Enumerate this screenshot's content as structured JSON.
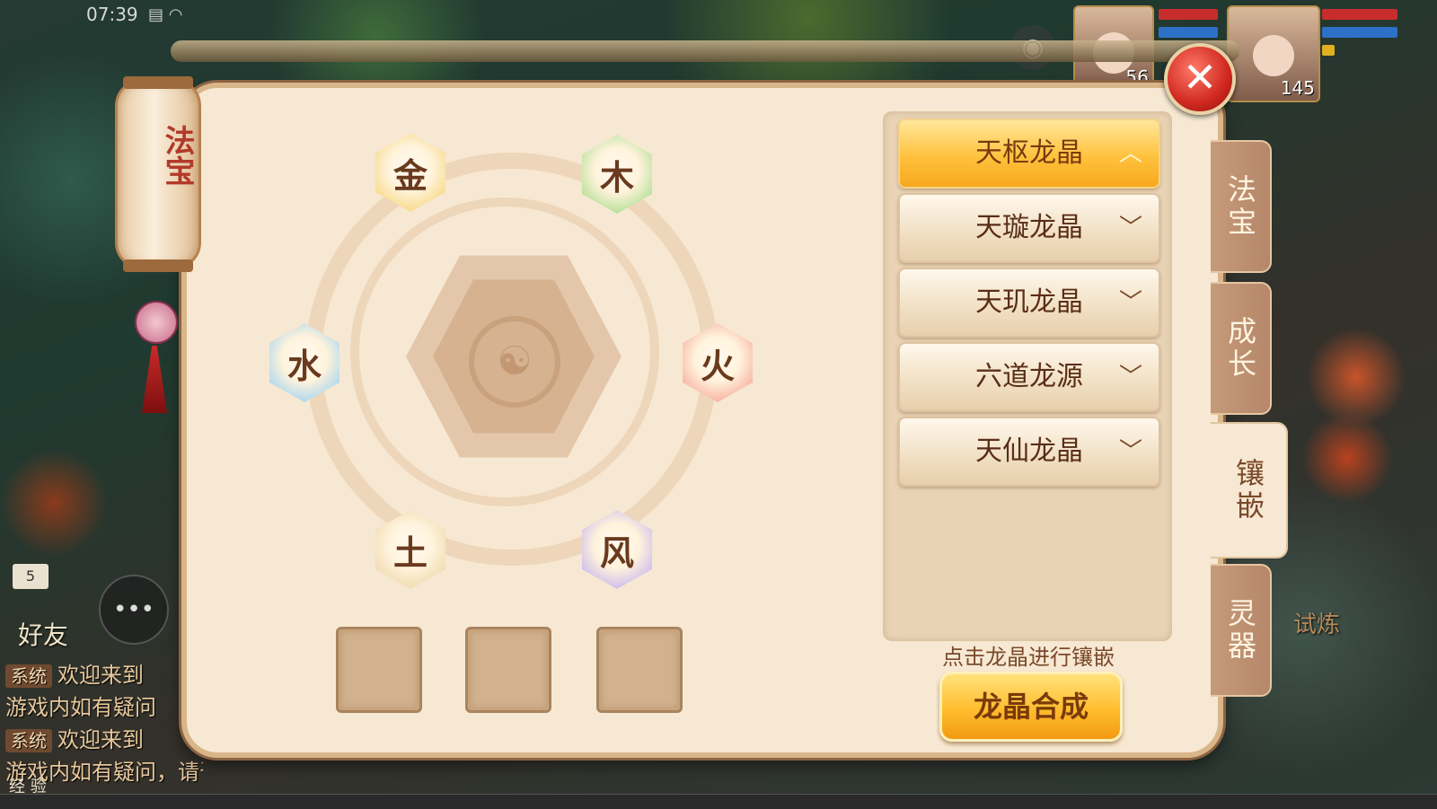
{
  "status_bar": {
    "time": "07:39"
  },
  "hud": {
    "pet_level": "56",
    "player_level": "145"
  },
  "panel": {
    "lantern_title": "法宝",
    "elements": [
      {
        "id": "metal",
        "glyph": "金",
        "color": "#f6d67a"
      },
      {
        "id": "wood",
        "glyph": "木",
        "color": "#a9dd8c"
      },
      {
        "id": "water",
        "glyph": "水",
        "color": "#9fd3f2"
      },
      {
        "id": "fire",
        "glyph": "火",
        "color": "#f7a79a"
      },
      {
        "id": "earth",
        "glyph": "土",
        "color": "#eed7a8"
      },
      {
        "id": "wind",
        "glyph": "风",
        "color": "#c5b3ef"
      }
    ],
    "crystals": [
      {
        "label": "天枢龙晶",
        "active": true,
        "chevron": "up"
      },
      {
        "label": "天璇龙晶",
        "active": false,
        "chevron": "down"
      },
      {
        "label": "天玑龙晶",
        "active": false,
        "chevron": "down"
      },
      {
        "label": "六道龙源",
        "active": false,
        "chevron": "down"
      },
      {
        "label": "天仙龙晶",
        "active": false,
        "chevron": "down"
      }
    ],
    "hint": "点击龙晶进行镶嵌",
    "synth_button": "龙晶合成",
    "tabs": [
      {
        "label": "法宝",
        "active": false
      },
      {
        "label": "成长",
        "active": false
      },
      {
        "label": "镶嵌",
        "active": true
      },
      {
        "label": "灵器",
        "active": false
      }
    ]
  },
  "social": {
    "mail_count": "5",
    "friend_label": "好友",
    "chat": [
      {
        "tag": "系统",
        "text": "欢迎来到"
      },
      {
        "tag": "",
        "text": "游戏内如有疑问"
      },
      {
        "tag": "系统",
        "text": "欢迎来到"
      },
      {
        "tag": "",
        "text": "游戏内如有疑问，请咨询官方！"
      }
    ],
    "exp_label": "经 验"
  },
  "event_label": "试炼"
}
